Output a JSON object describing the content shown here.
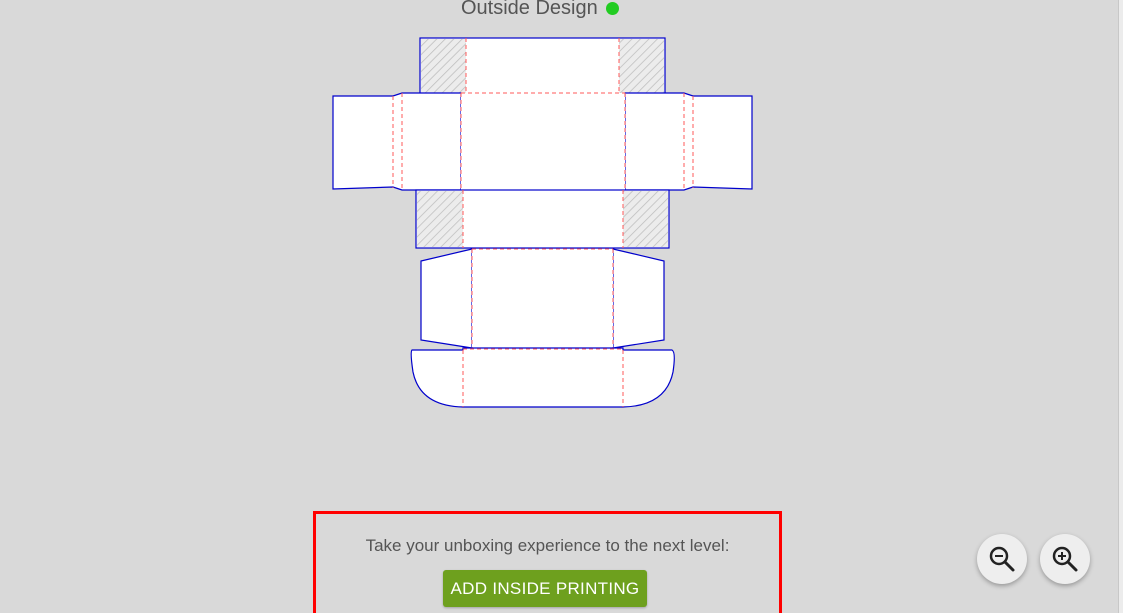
{
  "header": {
    "title": "Outside Design",
    "status_color": "#22cc22"
  },
  "dieline": {
    "outline_color": "#0000cc",
    "fold_color": "#ff5a5a"
  },
  "promo": {
    "text": "Take your unboxing experience to the next level:",
    "button_label": "ADD INSIDE PRINTING",
    "highlight_color": "#ff0000",
    "button_color": "#6ea01e"
  },
  "zoom": {
    "out_icon": "zoom-out-icon",
    "in_icon": "zoom-in-icon"
  }
}
